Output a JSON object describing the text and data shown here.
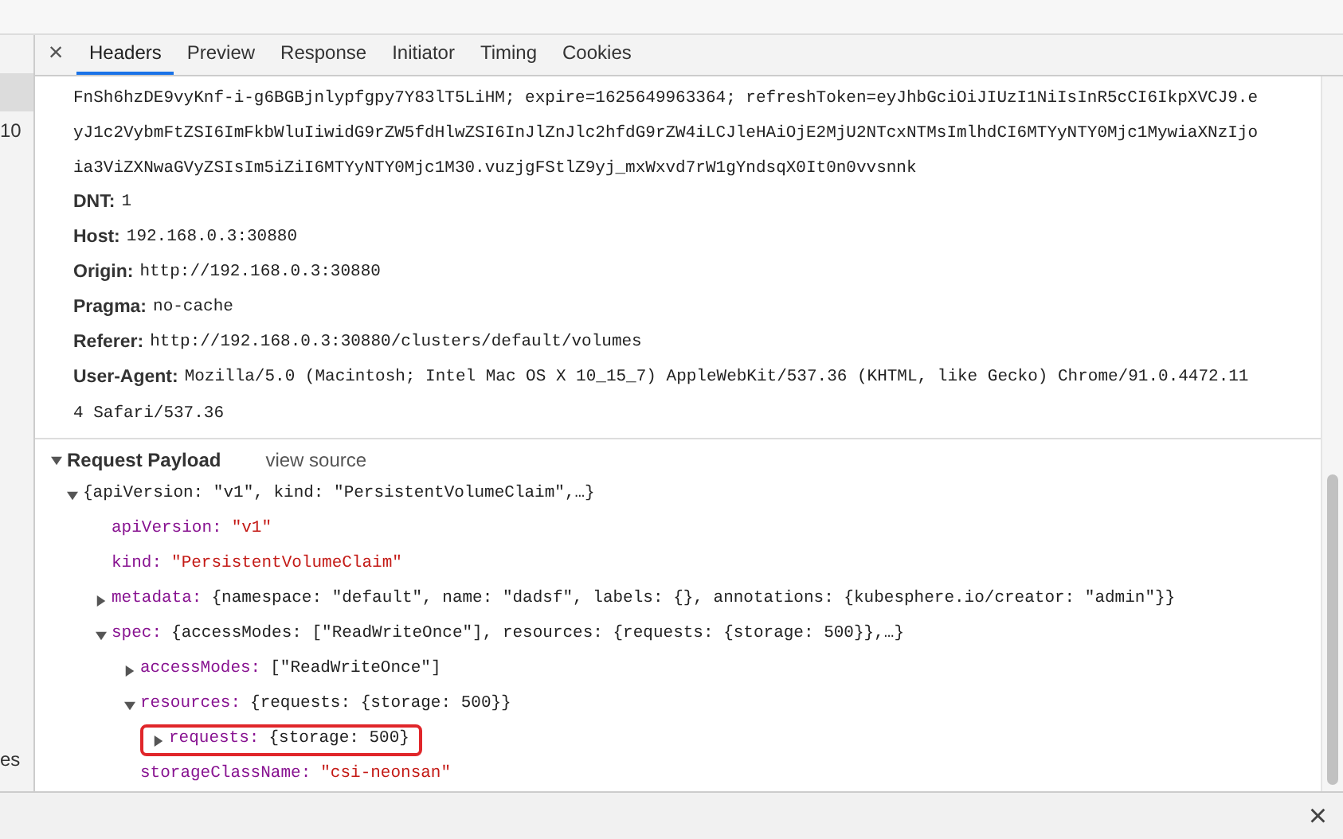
{
  "left_column": [
    {
      "text": "10"
    },
    {
      "text": "es"
    }
  ],
  "tabs": [
    {
      "label": "Headers",
      "selected": true
    },
    {
      "label": "Preview",
      "selected": false
    },
    {
      "label": "Response",
      "selected": false
    },
    {
      "label": "Initiator",
      "selected": false
    },
    {
      "label": "Timing",
      "selected": false
    },
    {
      "label": "Cookies",
      "selected": false
    }
  ],
  "close_glyph": "×",
  "cookie_lines": [
    "FnSh6hzDE9vyKnf-i-g6BGBjnlypfgpy7Y83lT5LiHM; expire=1625649963364; refreshToken=eyJhbGciOiJIUzI1NiIsInR5cCI6IkpXVCJ9.e",
    "yJ1c2VybmFtZSI6ImFkbWluIiwidG9rZW5fdHlwZSI6InJlZnJlc2hfdG9rZW4iLCJleHAiOjE2MjU2NTcxNTMsImlhdCI6MTYyNTY0Mjc1MywiaXNzIjo",
    "ia3ViZXNwaGVyZSIsIm5iZiI6MTYyNTY0Mjc1M30.vuzjgFStlZ9yj_mxWxvd7rW1gYndsqX0It0n0vvsnnk"
  ],
  "headers": [
    {
      "name": "DNT:",
      "value": "1"
    },
    {
      "name": "Host:",
      "value": "192.168.0.3:30880"
    },
    {
      "name": "Origin:",
      "value": "http://192.168.0.3:30880"
    },
    {
      "name": "Pragma:",
      "value": "no-cache"
    },
    {
      "name": "Referer:",
      "value": "http://192.168.0.3:30880/clusters/default/volumes"
    },
    {
      "name": "User-Agent:",
      "value": "Mozilla/5.0 (Macintosh; Intel Mac OS X 10_15_7) AppleWebKit/537.36 (KHTML, like Gecko) Chrome/91.0.4472.11",
      "continuation": "4 Safari/537.36"
    }
  ],
  "payload": {
    "title": "Request Payload",
    "expanded": true,
    "view_source": "view source",
    "tree": [
      {
        "summary": "{apiVersion: \"v1\", kind: \"PersistentVolumeClaim\",…}",
        "expandable": true,
        "expanded": true,
        "highlighted": false,
        "children": [
          {
            "key": "apiVersion:",
            "value": "\"v1\"",
            "kind": "string",
            "expandable": false,
            "expanded": false,
            "highlighted": false
          },
          {
            "key": "kind:",
            "value": "\"PersistentVolumeClaim\"",
            "kind": "string",
            "expandable": false,
            "expanded": false,
            "highlighted": false
          },
          {
            "key": "metadata:",
            "value": "{namespace: \"default\", name: \"dadsf\", labels: {}, annotations: {kubesphere.io/creator: \"admin\"}}",
            "kind": "object",
            "expandable": true,
            "expanded": false,
            "highlighted": false
          },
          {
            "key": "spec:",
            "value": "{accessModes: [\"ReadWriteOnce\"], resources: {requests: {storage: 500}},…}",
            "kind": "object",
            "expandable": true,
            "expanded": true,
            "highlighted": false,
            "children": [
              {
                "key": "accessModes:",
                "value": "[\"ReadWriteOnce\"]",
                "kind": "object",
                "expandable": true,
                "expanded": false,
                "highlighted": false
              },
              {
                "key": "resources:",
                "value": "{requests: {storage: 500}}",
                "kind": "object",
                "expandable": true,
                "expanded": true,
                "highlighted": false,
                "children": [
                  {
                    "key": "requests:",
                    "value": "{storage: 500}",
                    "kind": "object",
                    "expandable": true,
                    "expanded": false,
                    "highlighted": true
                  }
                ]
              },
              {
                "key": "storageClassName:",
                "value": "\"csi-neonsan\"",
                "kind": "string",
                "expandable": false,
                "expanded": false,
                "highlighted": false
              }
            ]
          }
        ]
      }
    ]
  },
  "bottom_close": "×"
}
